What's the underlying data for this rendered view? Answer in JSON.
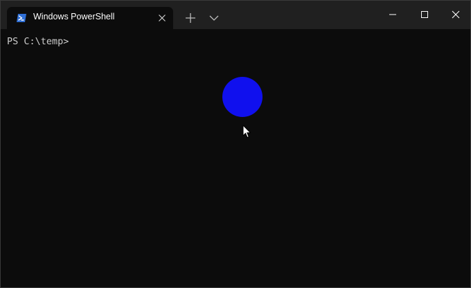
{
  "window": {
    "tab": {
      "title": "Windows PowerShell",
      "icon": "powershell-icon",
      "icon_color": "#2f6fd6"
    },
    "buttons": {
      "new_tab_icon": "plus-icon",
      "dropdown_icon": "chevron-down-icon",
      "minimize_icon": "minimize-icon",
      "maximize_icon": "maximize-icon",
      "close_icon": "close-icon"
    }
  },
  "terminal": {
    "prompt": "PS C:\\temp>",
    "background_color": "#0c0c0c",
    "text_color": "#cccccc"
  },
  "overlay": {
    "click_indicator_color": "#1010ee",
    "cursor_icon": "mouse-pointer-icon"
  }
}
